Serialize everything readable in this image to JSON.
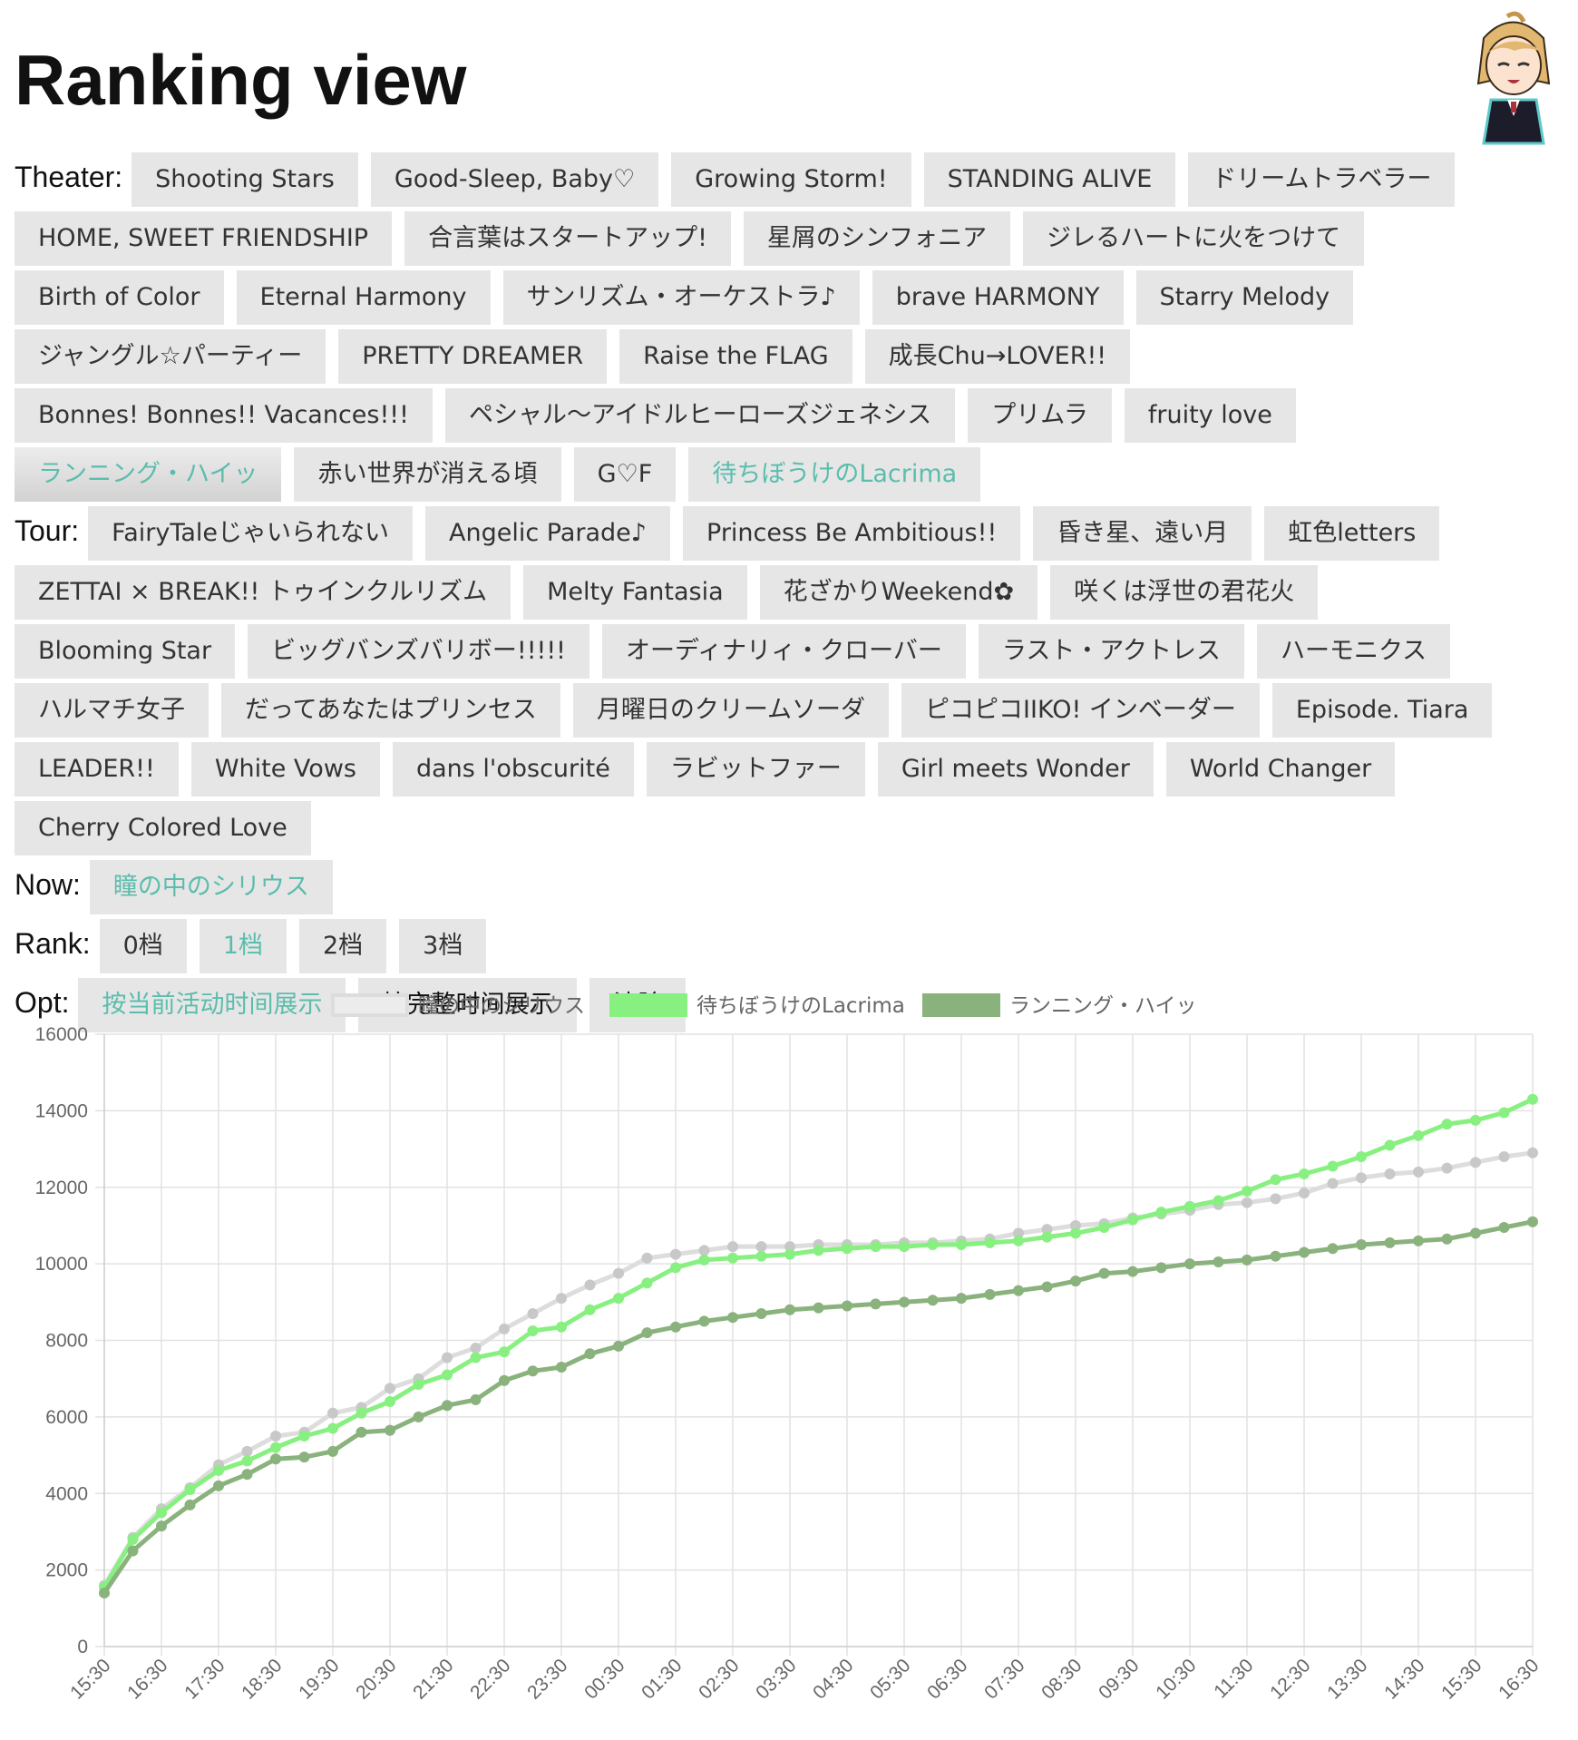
{
  "page": {
    "title": "Ranking view"
  },
  "labels": {
    "theater": "Theater:",
    "tour": "Tour:",
    "now": "Now:",
    "rank": "Rank:",
    "opt": "Opt:"
  },
  "theater": [
    {
      "label": "Shooting Stars"
    },
    {
      "label": "Good-Sleep, Baby♡"
    },
    {
      "label": "Growing Storm!"
    },
    {
      "label": "STANDING ALIVE"
    },
    {
      "label": "ドリームトラベラー"
    },
    {
      "label": "HOME, SWEET FRIENDSHIP"
    },
    {
      "label": "合言葉はスタートアップ!"
    },
    {
      "label": "星屑のシンフォニア"
    },
    {
      "label": "ジレるハートに火をつけて"
    },
    {
      "label": "Birth of Color"
    },
    {
      "label": "Eternal Harmony"
    },
    {
      "label": "サンリズム・オーケストラ♪"
    },
    {
      "label": "brave HARMONY"
    },
    {
      "label": "Starry Melody"
    },
    {
      "label": "ジャングル☆パーティー"
    },
    {
      "label": "PRETTY DREAMER"
    },
    {
      "label": "Raise the FLAG"
    },
    {
      "label": "成長Chu→LOVER!!"
    },
    {
      "label": "Bonnes! Bonnes!! Vacances!!!"
    },
    {
      "label": "ペシャル～アイドルヒーローズジェネシス"
    },
    {
      "label": "プリムラ"
    },
    {
      "label": "fruity love"
    },
    {
      "label": "ランニング・ハイッ",
      "state": "pressed"
    },
    {
      "label": "赤い世界が消える頃"
    },
    {
      "label": "G♡F"
    },
    {
      "label": "待ちぼうけのLacrima",
      "state": "active"
    }
  ],
  "tour": [
    {
      "label": "FairyTaleじゃいられない"
    },
    {
      "label": "Angelic Parade♪"
    },
    {
      "label": "Princess Be Ambitious!!"
    },
    {
      "label": "昏き星、遠い月"
    },
    {
      "label": "虹色letters"
    },
    {
      "label": "ZETTAI × BREAK!! トゥインクルリズム"
    },
    {
      "label": "Melty Fantasia"
    },
    {
      "label": "花ざかりWeekend✿"
    },
    {
      "label": "咲くは浮世の君花火"
    },
    {
      "label": "Blooming Star"
    },
    {
      "label": "ビッグバンズバリボー!!!!!"
    },
    {
      "label": "オーディナリィ・クローバー"
    },
    {
      "label": "ラスト・アクトレス"
    },
    {
      "label": "ハーモニクス"
    },
    {
      "label": "ハルマチ女子"
    },
    {
      "label": "だってあなたはプリンセス"
    },
    {
      "label": "月曜日のクリームソーダ"
    },
    {
      "label": "ピコピコIIKO! インベーダー"
    },
    {
      "label": "Episode. Tiara"
    },
    {
      "label": "LEADER!!"
    },
    {
      "label": "White Vows"
    },
    {
      "label": "dans l'obscurité"
    },
    {
      "label": "ラビットファー"
    },
    {
      "label": "Girl meets Wonder"
    },
    {
      "label": "World Changer"
    },
    {
      "label": "Cherry Colored Love"
    }
  ],
  "now": [
    {
      "label": "瞳の中のシリウス",
      "state": "active"
    }
  ],
  "rank": [
    {
      "label": "0档"
    },
    {
      "label": "1档",
      "state": "active"
    },
    {
      "label": "2档"
    },
    {
      "label": "3档"
    }
  ],
  "opt": [
    {
      "label": "按当前活动时间展示",
      "state": "active"
    },
    {
      "label": "按完整时间展示",
      "state": "dark"
    },
    {
      "label": "清除",
      "state": "dark"
    }
  ],
  "chart_data": {
    "type": "line",
    "x": [
      "15:30",
      "16:00",
      "16:30",
      "17:00",
      "17:30",
      "18:00",
      "18:30",
      "19:00",
      "19:30",
      "20:00",
      "20:30",
      "21:00",
      "21:30",
      "22:00",
      "22:30",
      "23:00",
      "23:30",
      "00:00",
      "00:30",
      "01:00",
      "01:30",
      "02:00",
      "02:30",
      "03:00",
      "03:30",
      "04:00",
      "04:30",
      "05:00",
      "05:30",
      "06:00",
      "06:30",
      "07:00",
      "07:30",
      "08:00",
      "08:30",
      "09:00",
      "09:30",
      "10:00",
      "10:30",
      "11:00",
      "11:30",
      "12:00",
      "12:30",
      "13:00",
      "13:30",
      "14:00",
      "14:30",
      "15:00",
      "15:30",
      "16:00",
      "16:30"
    ],
    "xtick_labels": [
      "15:30",
      "16:30",
      "17:30",
      "18:30",
      "19:30",
      "20:30",
      "21:30",
      "22:30",
      "23:30",
      "00:30",
      "01:30",
      "02:30",
      "03:30",
      "04:30",
      "05:30",
      "06:30",
      "07:30",
      "08:30",
      "09:30",
      "10:30",
      "11:30",
      "12:30",
      "13:30",
      "14:30",
      "15:30",
      "16:30"
    ],
    "yticks": [
      0,
      2000,
      4000,
      6000,
      8000,
      10000,
      12000,
      14000,
      16000
    ],
    "ylim": [
      0,
      16000
    ],
    "grid": true,
    "legend": "top-center",
    "series": [
      {
        "name": "瞳の中のシリウス",
        "color": "#dddddd",
        "style": "outline",
        "values": [
          1600,
          2850,
          3600,
          4150,
          4750,
          5100,
          5500,
          5600,
          6100,
          6250,
          6750,
          7000,
          7550,
          7800,
          8300,
          8700,
          9100,
          9450,
          9750,
          10150,
          10250,
          10350,
          10450,
          10450,
          10450,
          10500,
          10500,
          10500,
          10550,
          10550,
          10600,
          10650,
          10800,
          10900,
          11000,
          11050,
          11200,
          11300,
          11400,
          11550,
          11600,
          11700,
          11850,
          12100,
          12250,
          12350,
          12400,
          12500,
          12650,
          12800,
          12900
        ]
      },
      {
        "name": "待ちぼうけのLacrima",
        "color": "#88f080",
        "style": "fill",
        "values": [
          1550,
          2800,
          3500,
          4100,
          4600,
          4850,
          5200,
          5500,
          5700,
          6100,
          6400,
          6850,
          7100,
          7550,
          7700,
          8250,
          8350,
          8800,
          9100,
          9500,
          9900,
          10100,
          10150,
          10200,
          10250,
          10350,
          10400,
          10450,
          10450,
          10500,
          10500,
          10550,
          10600,
          10700,
          10800,
          10950,
          11150,
          11350,
          11500,
          11650,
          11900,
          12200,
          12350,
          12550,
          12800,
          13100,
          13350,
          13650,
          13750,
          13950,
          14300
        ]
      },
      {
        "name": "ランニング・ハイッ",
        "color": "#89b27d",
        "style": "fill",
        "values": [
          1400,
          2500,
          3150,
          3700,
          4200,
          4500,
          4900,
          4950,
          5100,
          5600,
          5650,
          6000,
          6300,
          6450,
          6950,
          7200,
          7300,
          7650,
          7850,
          8200,
          8350,
          8500,
          8600,
          8700,
          8800,
          8850,
          8900,
          8950,
          9000,
          9050,
          9100,
          9200,
          9300,
          9400,
          9550,
          9750,
          9800,
          9900,
          10000,
          10050,
          10100,
          10200,
          10300,
          10400,
          10500,
          10550,
          10600,
          10650,
          10800,
          10950,
          11100
        ]
      }
    ]
  }
}
